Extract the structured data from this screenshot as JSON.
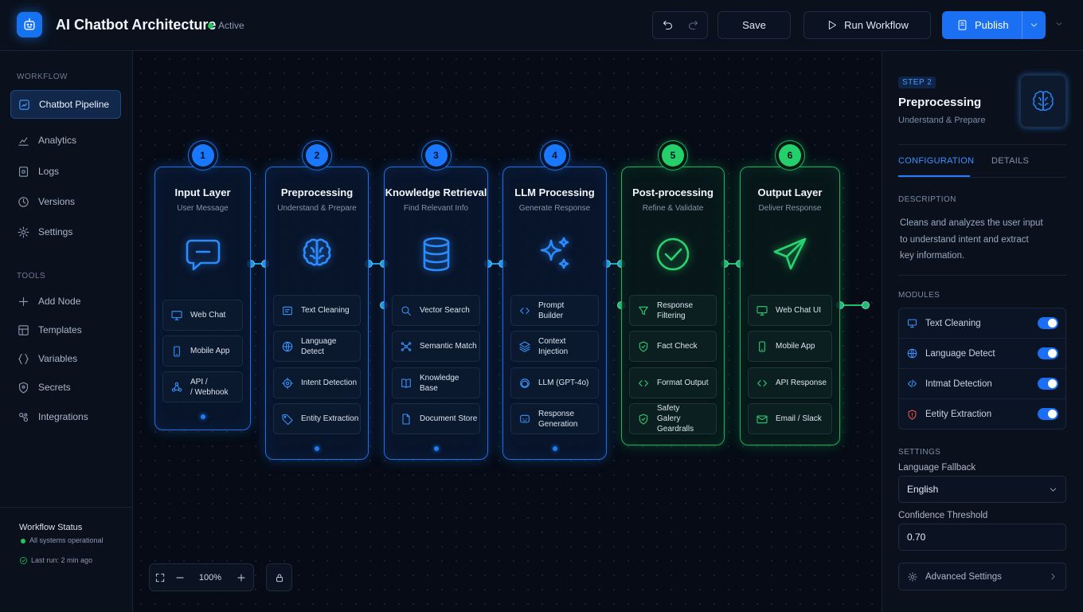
{
  "header": {
    "title": "AI Chatbot Architecture",
    "status": "Active",
    "save_label": "Save",
    "run_label": "Run Workflow",
    "publish_label": "Publish"
  },
  "sidebar": {
    "workflow_heading": "WORKFLOW",
    "workflow_items": [
      {
        "label": "Chatbot Pipeline",
        "icon": "workflow-icon"
      },
      {
        "label": "Analytics",
        "icon": "analytics-icon"
      },
      {
        "label": "Logs",
        "icon": "logs-icon"
      },
      {
        "label": "Versions",
        "icon": "versions-icon"
      },
      {
        "label": "Settings",
        "icon": "gear-icon"
      }
    ],
    "tools_heading": "TOOLS",
    "tools_items": [
      {
        "label": "Add Node",
        "icon": "plus-icon"
      },
      {
        "label": "Templates",
        "icon": "templates-icon"
      },
      {
        "label": "Variables",
        "icon": "variables-icon"
      },
      {
        "label": "Secrets",
        "icon": "secrets-icon"
      },
      {
        "label": "Integrations",
        "icon": "integrations-icon"
      }
    ],
    "status": {
      "title": "Workflow Status",
      "health": "All systems operational",
      "last_run": "Last run: 2 min ago"
    }
  },
  "canvas": {
    "zoom": "100%",
    "nodes": [
      {
        "step": "1",
        "title": "Input Layer",
        "subtitle": "User Message",
        "icon": "chat-bubble-icon",
        "color": "#1f6fe0",
        "modules": [
          {
            "label": "Web Chat",
            "icon": "monitor-icon"
          },
          {
            "label": "Mobile App",
            "icon": "phone-icon"
          },
          {
            "label": "API /\n/ Webhook",
            "icon": "webhook-icon"
          }
        ]
      },
      {
        "step": "2",
        "title": "Preprocessing",
        "subtitle": "Understand & Prepare",
        "icon": "brain-icon",
        "color": "#1f6fe0",
        "modules": [
          {
            "label": "Text Cleaning",
            "icon": "text-icon"
          },
          {
            "label": "Language\nDetect",
            "icon": "globe-icon"
          },
          {
            "label": "Intent Detection",
            "icon": "target-icon"
          },
          {
            "label": "Entity Extraction",
            "icon": "tag-icon"
          }
        ]
      },
      {
        "step": "3",
        "title": "Knowledge Retrieval",
        "subtitle": "Find Relevant Info",
        "icon": "database-icon",
        "color": "#1f6fe0",
        "modules": [
          {
            "label": "Vector Search",
            "icon": "search-icon"
          },
          {
            "label": "Semantic Match",
            "icon": "network-icon"
          },
          {
            "label": "Knowledge\nBase",
            "icon": "book-icon"
          },
          {
            "label": "Document Store",
            "icon": "document-icon"
          }
        ]
      },
      {
        "step": "4",
        "title": "LLM Processing",
        "subtitle": "Generate Response",
        "icon": "sparkles-icon",
        "color": "#1f6fe0",
        "modules": [
          {
            "label": "Prompt\nBuilder",
            "icon": "code-icon"
          },
          {
            "label": "Context\nInjection",
            "icon": "layers-icon"
          },
          {
            "label": "LLM (GPT-4o)",
            "icon": "openai-icon"
          },
          {
            "label": "Response\nGeneration",
            "icon": "bot-icon"
          }
        ]
      },
      {
        "step": "5",
        "title": "Post-processing",
        "subtitle": "Refine & Validate",
        "icon": "check-circle-icon",
        "color": "#17b35f",
        "modules": [
          {
            "label": "Response\nFiltering",
            "icon": "filter-icon"
          },
          {
            "label": "Fact Check",
            "icon": "shield-check-icon"
          },
          {
            "label": "Format Output",
            "icon": "code-icon"
          },
          {
            "label": "Safety\nGalery Geardralls",
            "icon": "shield-check-icon"
          }
        ]
      },
      {
        "step": "6",
        "title": "Output Layer",
        "subtitle": "Deliver Response",
        "icon": "paper-plane-icon",
        "color": "#17b35f",
        "modules": [
          {
            "label": "Web Chat UI",
            "icon": "monitor-icon"
          },
          {
            "label": "Mobile App",
            "icon": "phone-icon"
          },
          {
            "label": "API Response",
            "icon": "code-icon"
          },
          {
            "label": "Email / Slack",
            "icon": "mail-icon"
          }
        ]
      }
    ]
  },
  "panel": {
    "step_badge": "STEP 2",
    "title": "Preprocessing",
    "subtitle": "Understand & Prepare",
    "tabs": [
      "CONFIGURATION",
      "DETAILS"
    ],
    "description_heading": "DESCRIPTION",
    "description": "Cleans and analyzes the user input to understand intent and extract key information.",
    "modules_heading": "MODULES",
    "modules": [
      {
        "label": "Text Cleaning",
        "icon": "text-icon",
        "enabled": true
      },
      {
        "label": "Language Detect",
        "icon": "globe-icon",
        "enabled": true
      },
      {
        "label": "Intmat Detection",
        "icon": "code-icon",
        "enabled": true
      },
      {
        "label": "Eetity Extraction",
        "icon": "shield-alert-icon",
        "enabled": true
      }
    ],
    "settings_heading": "SETTINGS",
    "language_fallback_label": "Language Fallback",
    "language_fallback_value": "English",
    "confidence_label": "Confidence Threshold",
    "confidence_value": "0.70",
    "advanced_label": "Advanced Settings"
  }
}
